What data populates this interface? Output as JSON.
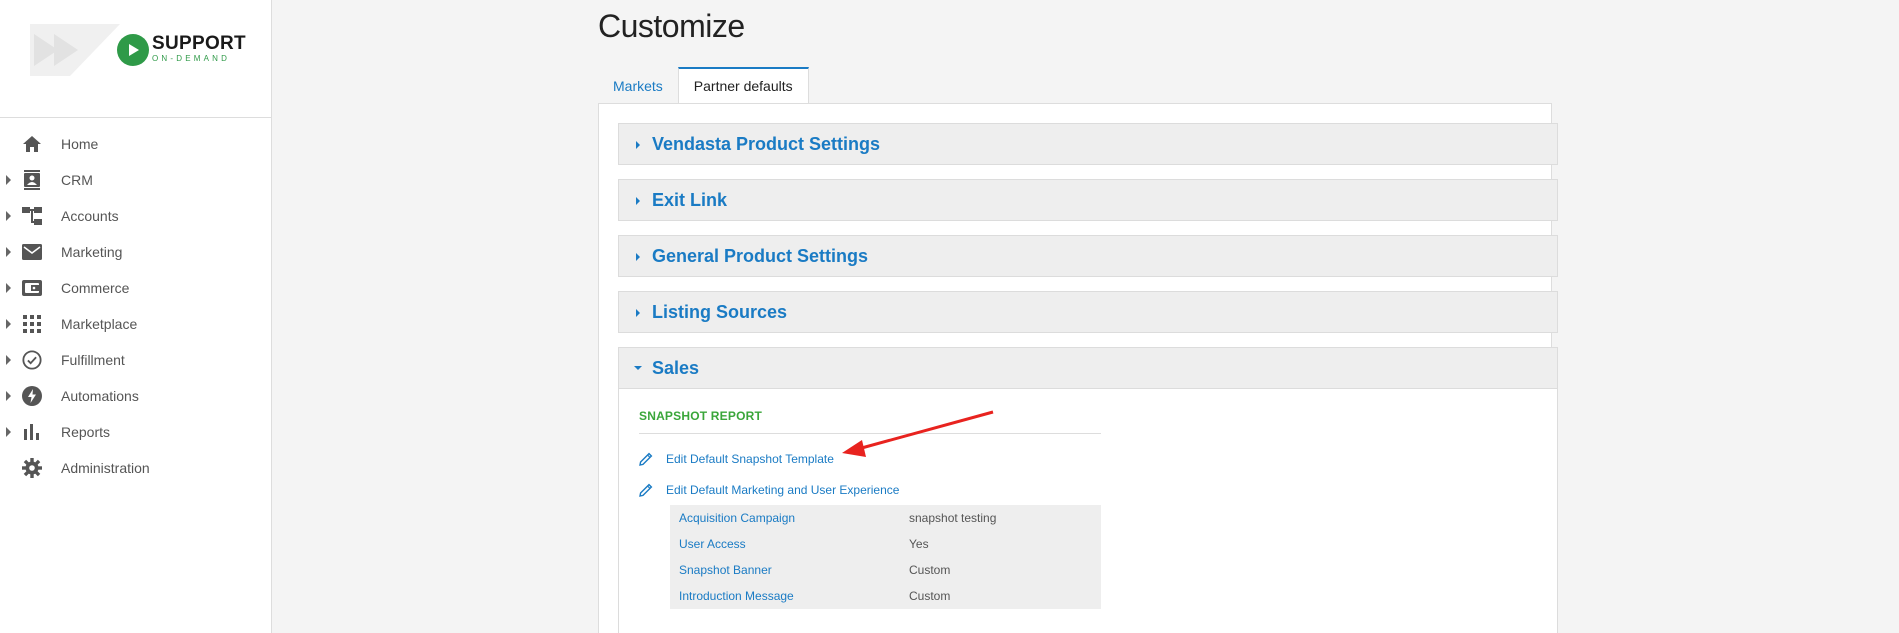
{
  "brand": {
    "name": "SUPPORT",
    "tagline": "ON-DEMAND"
  },
  "sidebar": {
    "items": [
      {
        "label": "Home",
        "icon": "home-icon",
        "expandable": false
      },
      {
        "label": "CRM",
        "icon": "contact-card-icon",
        "expandable": true
      },
      {
        "label": "Accounts",
        "icon": "accounts-tree-icon",
        "expandable": true
      },
      {
        "label": "Marketing",
        "icon": "mail-icon",
        "expandable": true
      },
      {
        "label": "Commerce",
        "icon": "wallet-icon",
        "expandable": true
      },
      {
        "label": "Marketplace",
        "icon": "grid-icon",
        "expandable": true
      },
      {
        "label": "Fulfillment",
        "icon": "check-circle-icon",
        "expandable": true
      },
      {
        "label": "Automations",
        "icon": "bolt-icon",
        "expandable": true
      },
      {
        "label": "Reports",
        "icon": "bar-chart-icon",
        "expandable": true
      },
      {
        "label": "Administration",
        "icon": "gear-icon",
        "expandable": false
      }
    ]
  },
  "page": {
    "title": "Customize"
  },
  "tabs": [
    {
      "label": "Markets",
      "active": false
    },
    {
      "label": "Partner defaults",
      "active": true
    }
  ],
  "accordions": [
    {
      "title": "Vendasta Product Settings",
      "open": false
    },
    {
      "title": "Exit Link",
      "open": false
    },
    {
      "title": "General Product Settings",
      "open": false
    },
    {
      "title": "Listing Sources",
      "open": false
    },
    {
      "title": "Sales",
      "open": true
    }
  ],
  "sales": {
    "section_heading": "SNAPSHOT REPORT",
    "links": [
      {
        "label": "Edit Default Snapshot Template",
        "icon": "pencil-icon"
      },
      {
        "label": "Edit Default Marketing and User Experience",
        "icon": "pencil-icon"
      }
    ],
    "table": [
      {
        "key": "Acquisition Campaign",
        "value": "snapshot testing"
      },
      {
        "key": "User Access",
        "value": "Yes"
      },
      {
        "key": "Snapshot Banner",
        "value": "Custom"
      },
      {
        "key": "Introduction Message",
        "value": "Custom"
      }
    ]
  },
  "colors": {
    "link": "#1a7bc4",
    "heading_green": "#3aa63a",
    "annotation": "#e8231f",
    "brand_green": "#2f9a48"
  }
}
